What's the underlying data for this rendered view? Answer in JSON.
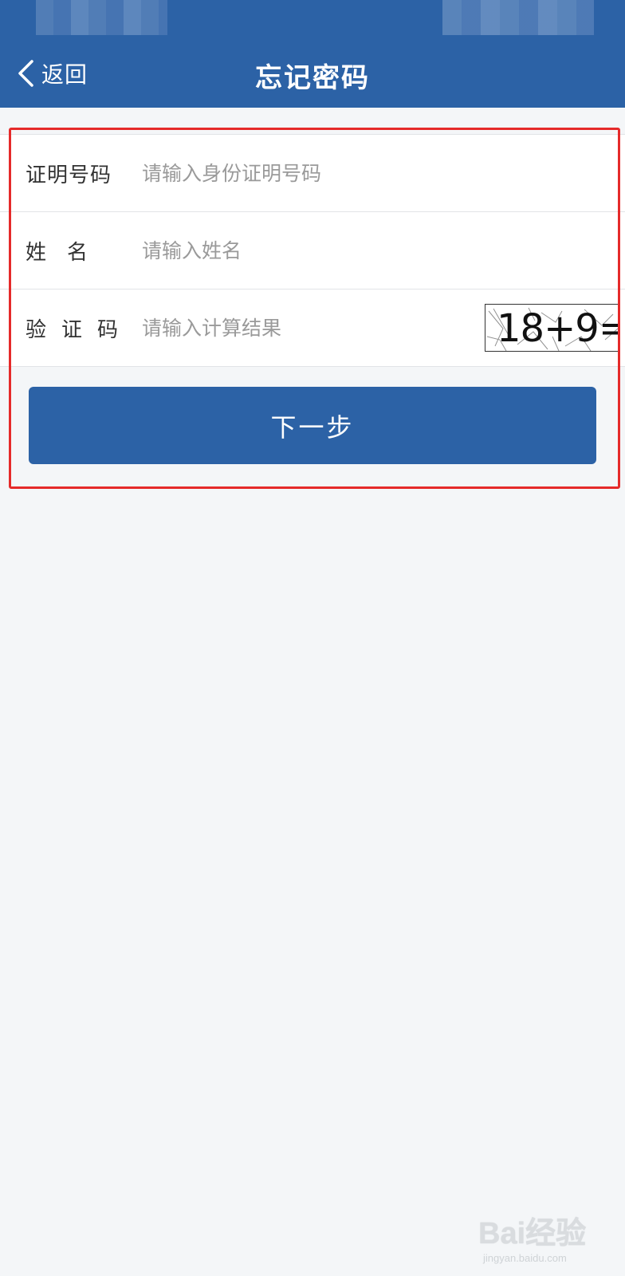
{
  "colors": {
    "header_bg": "#2c62a6",
    "button_bg": "#2c62a6",
    "page_bg": "#f4f6f8",
    "highlight": "#e52a2a"
  },
  "header": {
    "back_label": "返回",
    "back_icon": "chevron-left-icon",
    "title": "忘记密码"
  },
  "form": {
    "rows": [
      {
        "label": "证明号码",
        "placeholder": "请输入身份证明号码",
        "value": ""
      },
      {
        "label": "姓名",
        "placeholder": "请输入姓名",
        "value": ""
      },
      {
        "label": "验证码",
        "placeholder": "请输入计算结果",
        "value": ""
      }
    ],
    "captcha_text": "18+9="
  },
  "next_button": {
    "label": "下一步"
  },
  "watermark": {
    "logo": "Bai经验",
    "sub": "jingyan.baidu.com"
  }
}
